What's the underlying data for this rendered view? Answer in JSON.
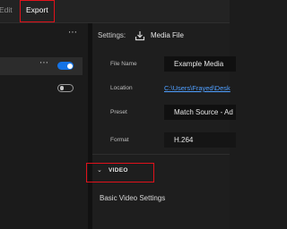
{
  "menu": {
    "edit_label": "Edit",
    "export_label": "Export"
  },
  "left_panel": {
    "more_icon": "⋯",
    "rows": [
      {
        "more_icon": "⋯",
        "toggle_on": true
      },
      {
        "toggle_on": false
      }
    ]
  },
  "settings": {
    "label": "Settings:",
    "media_file_label": "Media File",
    "fields": {
      "file_name_label": "File Name",
      "file_name_value": "Example Media",
      "location_label": "Location",
      "location_value": "C:\\Users\\Frayed\\Desk",
      "preset_label": "Preset",
      "preset_value": "Match Source - Ad",
      "format_label": "Format",
      "format_value": "H.264"
    },
    "video_section": {
      "chevron": "⌄",
      "label": "VIDEO",
      "subheading": "Basic Video Settings"
    }
  },
  "colors": {
    "accent_blue": "#1473e6",
    "highlight_red": "#e0121b",
    "link_blue": "#4f9fff"
  }
}
